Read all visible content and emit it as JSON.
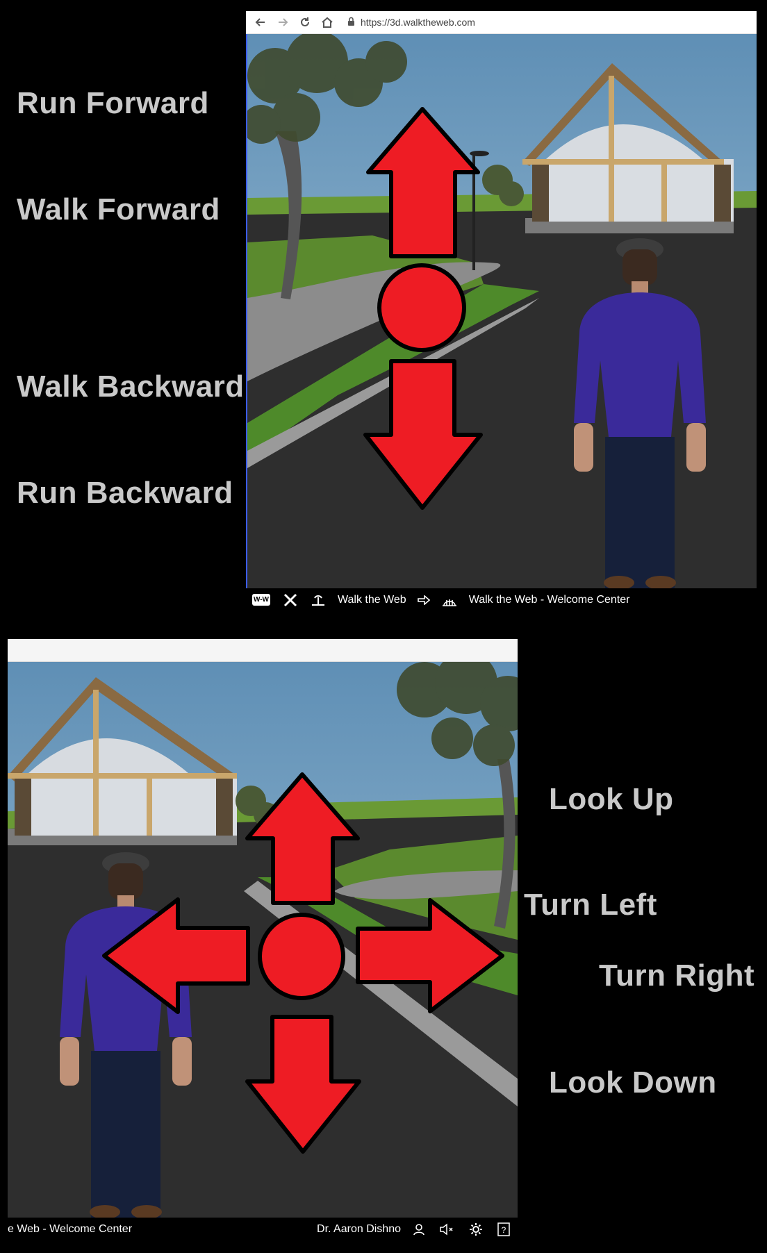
{
  "labels": {
    "run_forward": "Run Forward",
    "walk_forward": "Walk Forward",
    "walk_backward": "Walk Backward",
    "run_backward": "Run Backward",
    "look_up": "Look Up",
    "turn_left": "Turn Left",
    "turn_right": "Turn Right",
    "look_down": "Look Down"
  },
  "browser": {
    "url": "https://3d.walktheweb.com"
  },
  "top_bar": {
    "logo_text": "W-W",
    "site_link": "Walk the Web",
    "page_title": "Walk the Web - Welcome Center"
  },
  "bottom_bar": {
    "page_title_partial": "e Web - Welcome Center",
    "user_name": "Dr. Aaron Dishno"
  },
  "colors": {
    "arrow_fill": "#ee1c24",
    "sky": "#7fa8c8",
    "grass": "#5b8a2e",
    "road": "#2b2b2b",
    "shirt": "#3a2a9a"
  },
  "icons": [
    "back-icon",
    "forward-icon",
    "reload-icon",
    "home-icon",
    "lock-icon",
    "wtw-logo-icon",
    "tools-icon",
    "island-icon",
    "arrow-right-icon",
    "globe-building-icon",
    "user-icon",
    "mute-icon",
    "settings-gear-icon",
    "help-icon"
  ]
}
